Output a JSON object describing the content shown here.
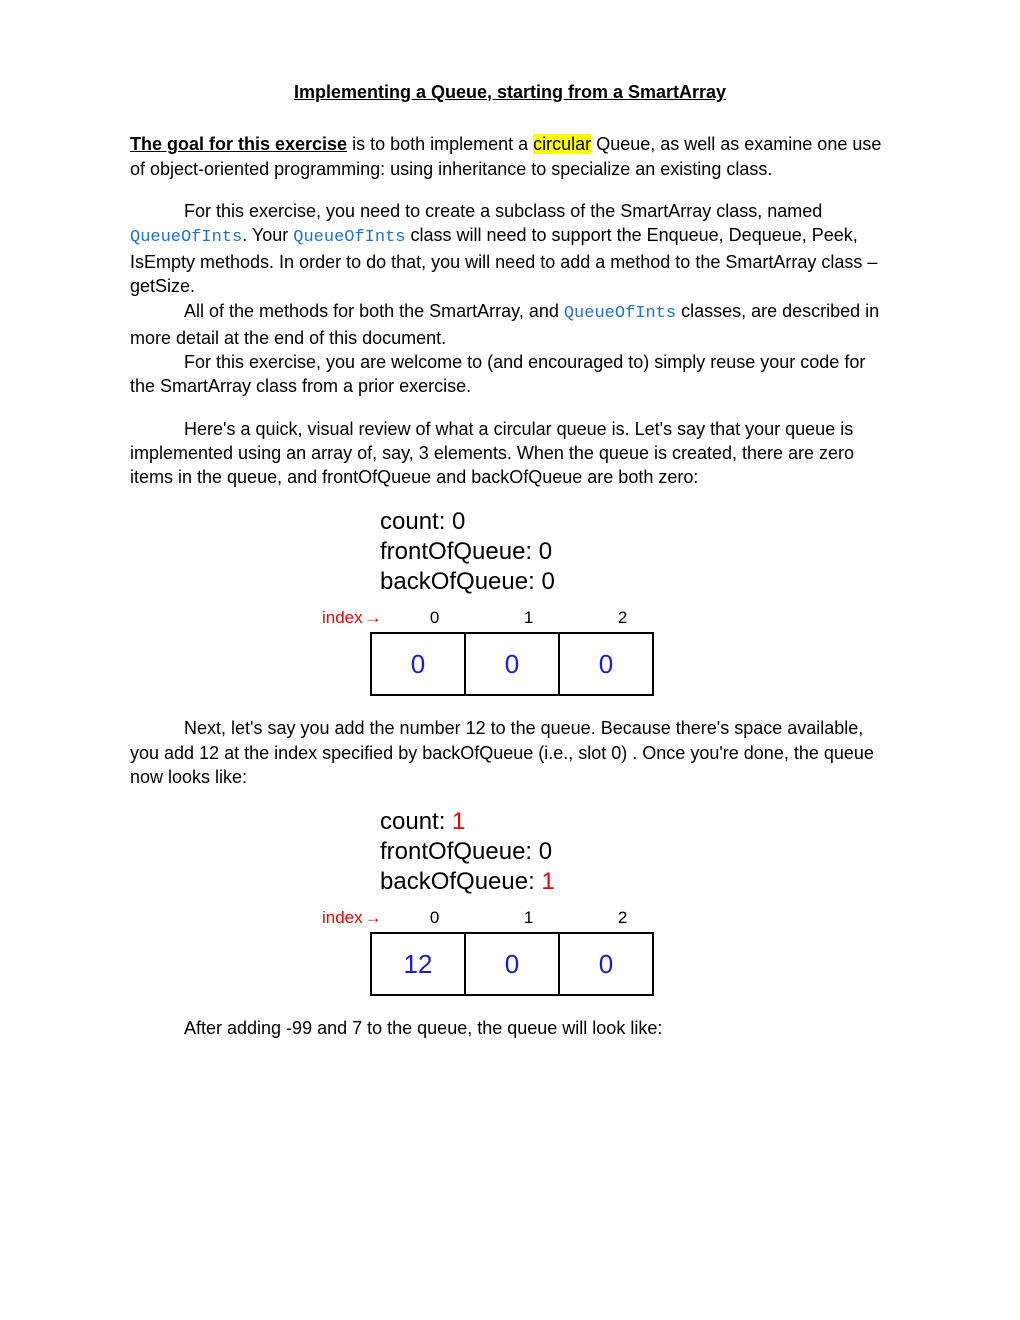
{
  "title": "Implementing a Queue, starting from a SmartArray",
  "goal_label": "The goal for this exercise",
  "goal_rest1": " is to both implement a ",
  "goal_hl": "circular",
  "goal_rest2": " Queue, as well as examine one use of object-oriented programming: using inheritance to specialize an existing class.",
  "p2a": "For this exercise, you need to create a subclass of the SmartArray class, named ",
  "code1": "QueueOfInts",
  "p2b": ".  Your ",
  "code2": "QueueOfInts",
  "p2c": " class will need to support the Enqueue, Dequeue, Peek, IsEmpty methods.  In order to do that, you will need to add a method to the SmartArray class – getSize.",
  "p3a": "All of the methods for both the SmartArray, and ",
  "code3": "QueueOfInts",
  "p3b": " classes, are described in more detail at the end of this document.",
  "p4": "For this exercise, you are welcome to (and encouraged to) simply reuse your code for the SmartArray class from a prior exercise.",
  "p5": "Here's a quick, visual review of what a circular queue is.  Let's say that your queue is implemented using an array of, say, 3 elements.  When the queue is created, there are zero items in the queue, and frontOfQueue and backOfQueue are both zero:",
  "diag1": {
    "count_label": "count:  ",
    "count_val": "0",
    "front_label": "frontOfQueue: ",
    "front_val": "0",
    "back_label": "backOfQueue: ",
    "back_val": "0",
    "count_red": false,
    "back_red": false,
    "idx_label": "index",
    "indices": [
      "0",
      "1",
      "2"
    ],
    "cells": [
      "0",
      "0",
      "0"
    ]
  },
  "p6": "Next, let's say you add the number 12 to the queue.  Because there's space available, you add 12 at the index specified by backOfQueue (i.e., slot 0) .  Once you're done, the queue now looks like:",
  "diag2": {
    "count_label": "count:  ",
    "count_val": "1",
    "front_label": "frontOfQueue: ",
    "front_val": "0",
    "back_label": "backOfQueue:  ",
    "back_val": "1",
    "count_red": true,
    "back_red": true,
    "idx_label": "index",
    "indices": [
      "0",
      "1",
      "2"
    ],
    "cells": [
      "12",
      "0",
      "0"
    ]
  },
  "p7": "After adding -99 and 7 to the queue, the queue will look like:"
}
